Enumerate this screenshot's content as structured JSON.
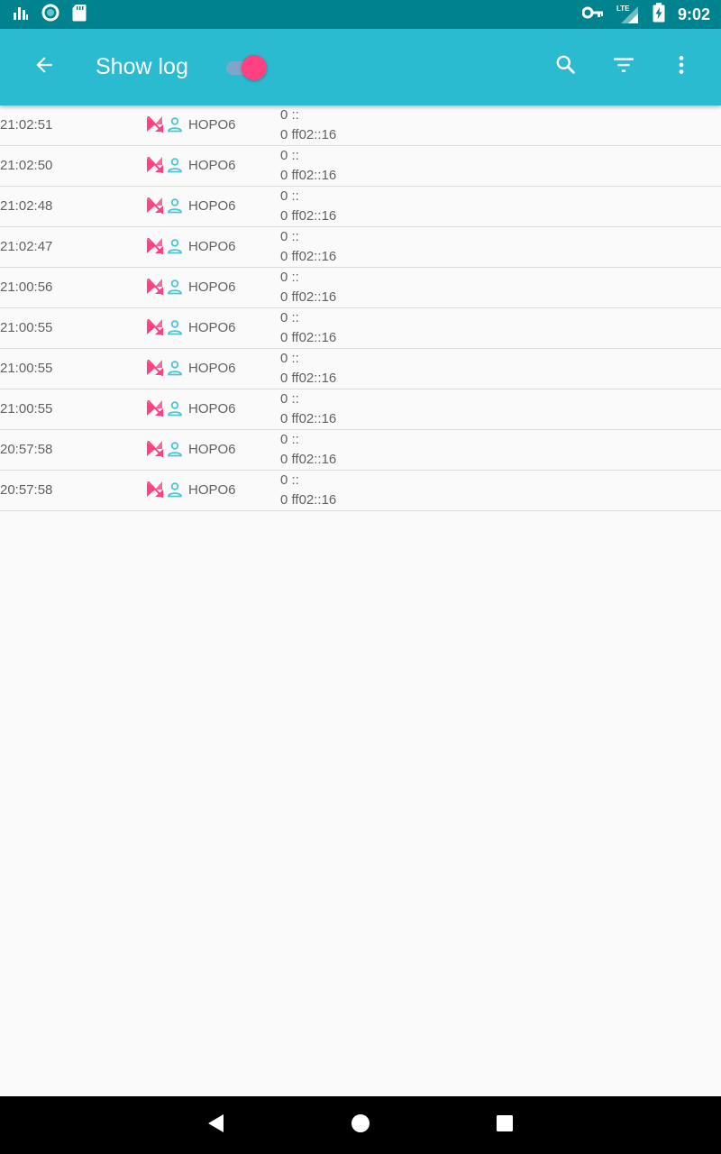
{
  "status_bar": {
    "time": "9:02",
    "network_label": "LTE"
  },
  "app_bar": {
    "title": "Show log",
    "toggle_on": true,
    "colors": {
      "bar": "#2bbbd0",
      "accent": "#ff4081"
    }
  },
  "log": {
    "rows": [
      {
        "time": "21:02:51",
        "app": "HOPO6",
        "src": "0 ::",
        "dst": "0 ff02::16"
      },
      {
        "time": "21:02:50",
        "app": "HOPO6",
        "src": "0 ::",
        "dst": "0 ff02::16"
      },
      {
        "time": "21:02:48",
        "app": "HOPO6",
        "src": "0 ::",
        "dst": "0 ff02::16"
      },
      {
        "time": "21:02:47",
        "app": "HOPO6",
        "src": "0 ::",
        "dst": "0 ff02::16"
      },
      {
        "time": "21:00:56",
        "app": "HOPO6",
        "src": "0 ::",
        "dst": "0 ff02::16"
      },
      {
        "time": "21:00:55",
        "app": "HOPO6",
        "src": "0 ::",
        "dst": "0 ff02::16"
      },
      {
        "time": "21:00:55",
        "app": "HOPO6",
        "src": "0 ::",
        "dst": "0 ff02::16"
      },
      {
        "time": "21:00:55",
        "app": "HOPO6",
        "src": "0 ::",
        "dst": "0 ff02::16"
      },
      {
        "time": "20:57:58",
        "app": "HOPO6",
        "src": "0 ::",
        "dst": "0 ff02::16"
      },
      {
        "time": "20:57:58",
        "app": "HOPO6",
        "src": "0 ::",
        "dst": "0 ff02::16"
      }
    ]
  },
  "icons": {
    "back": "arrow-back-icon",
    "search": "search-icon",
    "filter": "filter-icon",
    "more": "more-vert-icon",
    "row_blocked": "blocked-icon",
    "row_user": "person-icon"
  }
}
